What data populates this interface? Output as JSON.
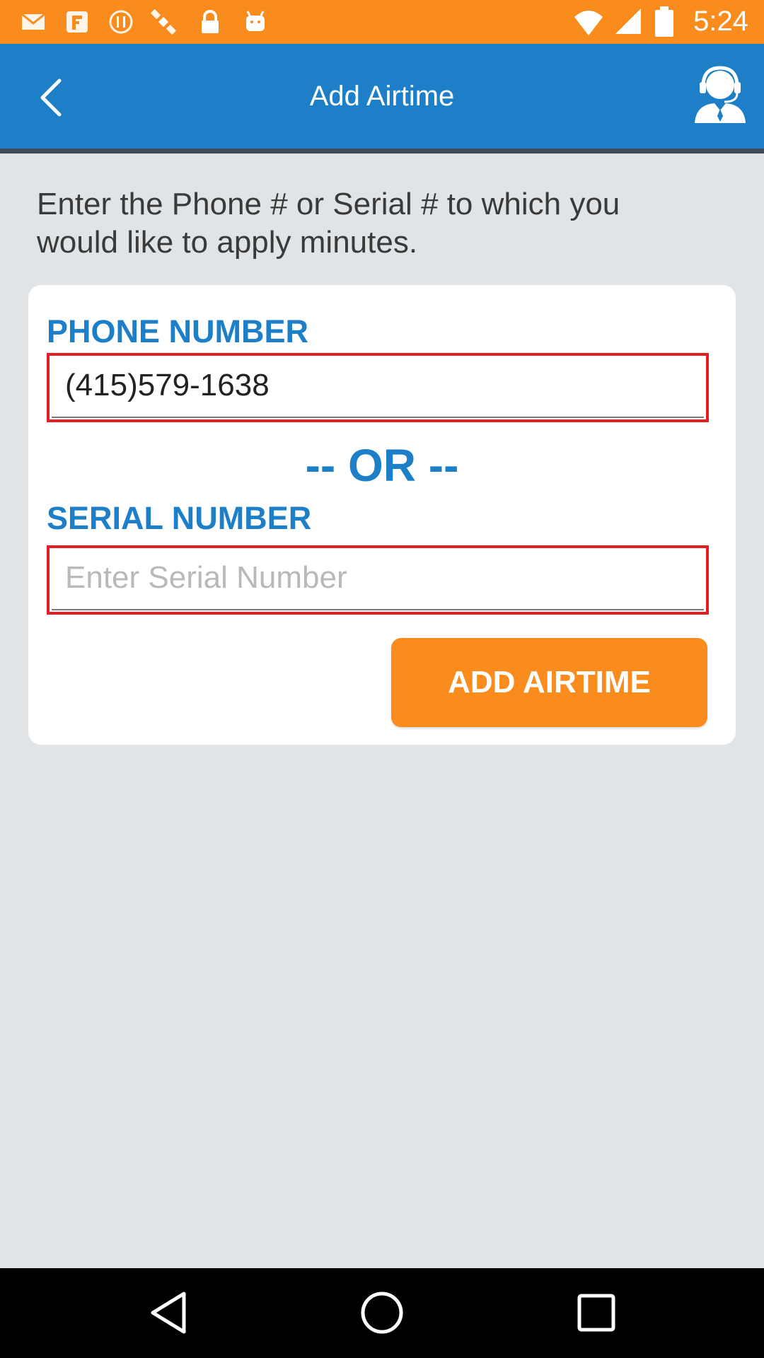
{
  "status_bar": {
    "time": "5:24",
    "icons": [
      "mail-icon",
      "fake-gps-icon",
      "alert-icon",
      "satellite-icon",
      "lock-icon",
      "android-icon",
      "wifi-icon",
      "signal-icon",
      "battery-icon"
    ]
  },
  "app_bar": {
    "title": "Add Airtime",
    "back_icon": "chevron-left-icon",
    "support_icon": "customer-support-icon"
  },
  "instructions": "Enter the Phone # or Serial # to which you would like to apply minutes.",
  "form": {
    "phone_label": "PHONE NUMBER",
    "phone_value": "(415)579-1638",
    "or_text": "-- OR --",
    "serial_label": "SERIAL NUMBER",
    "serial_value": "",
    "serial_placeholder": "Enter Serial Number",
    "submit_label": "ADD AIRTIME"
  },
  "nav_bar": {
    "buttons": [
      "back-triangle-icon",
      "home-circle-icon",
      "recents-square-icon"
    ]
  },
  "colors": {
    "accent_orange": "#f98c1d",
    "brand_blue": "#1c7fc7",
    "field_border_red": "#e41d25",
    "page_background": "#e0e4e6"
  }
}
